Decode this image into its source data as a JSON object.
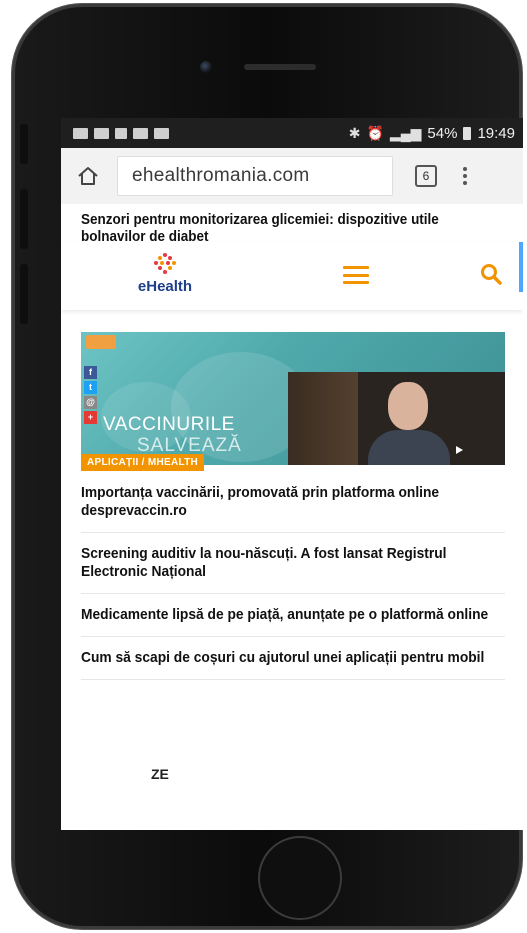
{
  "status_bar": {
    "battery": "54%",
    "time": "19:49"
  },
  "browser": {
    "url": "ehealthromania.com",
    "tab_count": "6"
  },
  "page": {
    "top_headline": "Senzori pentru monitorizarea glicemiei: dispozitive utile bolnavilor de diabet",
    "logo_text": "eHealth",
    "feature": {
      "image_title_line1": "VACCINURILE",
      "image_title_line2": "SALVEAZĂ",
      "category": "APLICAȚII / MHEALTH"
    },
    "articles": [
      {
        "title": "Importanța vaccinării, promovată prin platforma online desprevaccin.ro"
      },
      {
        "title": "Screening auditiv la nou-născuți. A fost lansat Registrul Electronic Național"
      },
      {
        "title": "Medicamente lipsă de pe piață, anunțate pe o platformă online"
      },
      {
        "title": "Cum să scapi de coșuri cu ajutorul unei aplicații pentru mobil"
      }
    ],
    "section_label": "ZE"
  },
  "colors": {
    "accent": "#f29400",
    "logo_blue": "#1e3f8a",
    "facebook": "#3b5998",
    "linkedin": "#0e76a8",
    "twitter": "#1da1f2",
    "email": "#c8c8c8",
    "crown": "#1565c0"
  },
  "icons": {
    "browser": [
      "home-icon",
      "tabs-count-icon",
      "menu-dots-icon"
    ],
    "header": [
      "hamburger-menu-icon",
      "search-icon"
    ],
    "share": [
      "facebook-icon",
      "linkedin-icon",
      "twitter-icon",
      "email-icon",
      "crown-icon"
    ]
  }
}
